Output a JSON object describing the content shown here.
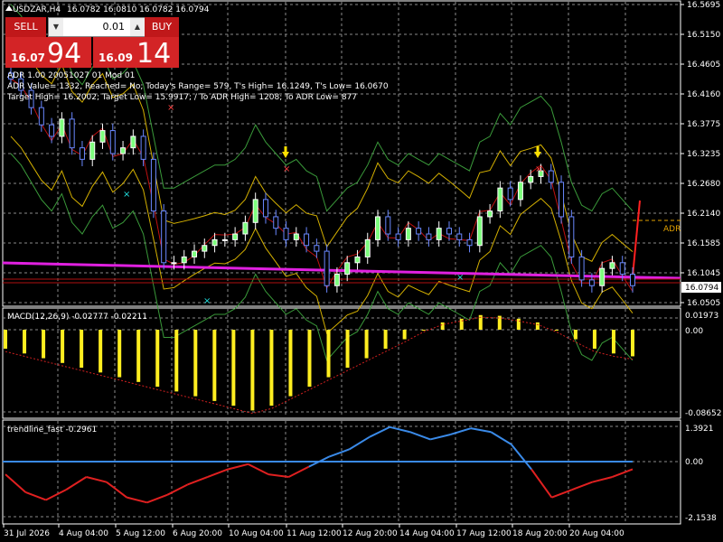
{
  "header": {
    "title": "USDZAR,H4",
    "ohlc": "16.0782 16.0810 16.0782 16.0794",
    "adr_line1": "ADR 1.00 20051027 01 Mod 01",
    "adr_line2": "ADR Value= 1332, Reached= No; Today's Range= 579, T's High= 16.1249, T's Low= 16.0670",
    "adr_line3": "Target High= 16.2002; Target Low= 15.9917; / To ADR High= 1208; To ADR Low= 877"
  },
  "trade": {
    "sell_label": "SELL",
    "buy_label": "BUY",
    "lot_value": "0.01",
    "sell_small": "16.07",
    "sell_big": "94",
    "buy_small": "16.09",
    "buy_big": "14"
  },
  "price_axis": {
    "labels": [
      "16.5695",
      "16.5150",
      "16.4605",
      "16.4160",
      "16.3775",
      "16.3235",
      "16.2680",
      "16.2140",
      "16.1585",
      "16.1045",
      "16.0505"
    ],
    "current": "16.0794",
    "adr_tag": "ADR"
  },
  "macd": {
    "label": "MACD(12,26,9) -0.02777 -0.02211",
    "axis": [
      "0.01973",
      "0.00",
      "-0.08652"
    ]
  },
  "trendline": {
    "label": "trendline_fast -0.2961",
    "axis": [
      "1.3921",
      "0.00",
      "-2.1538"
    ]
  },
  "time_axis": [
    "31 Jul 2026",
    "4 Aug 04:00",
    "5 Aug 12:00",
    "6 Aug 20:00",
    "10 Aug 04:00",
    "11 Aug 12:00",
    "12 Aug 20:00",
    "14 Aug 04:00",
    "17 Aug 12:00",
    "18 Aug 20:00",
    "20 Aug 04:00"
  ],
  "chart_data": {
    "type": "line",
    "symbol": "USDZAR",
    "timeframe": "H4",
    "ylim": [
      16.0505,
      16.5695
    ],
    "series": [
      {
        "name": "USDZAR",
        "values": [
          16.44,
          16.42,
          16.39,
          16.36,
          16.34,
          16.37,
          16.32,
          16.3,
          16.33,
          16.35,
          16.31,
          16.32,
          16.34,
          16.3,
          16.21,
          16.12,
          16.12,
          16.13,
          16.14,
          16.15,
          16.16,
          16.16,
          16.17,
          16.19,
          16.23,
          16.2,
          16.18,
          16.16,
          16.17,
          16.15,
          16.14,
          16.08,
          16.1,
          16.12,
          16.13,
          16.16,
          16.2,
          16.17,
          16.16,
          16.18,
          16.17,
          16.16,
          16.18,
          16.17,
          16.16,
          16.15,
          16.2,
          16.21,
          16.25,
          16.23,
          16.26,
          16.27,
          16.28,
          16.26,
          16.2,
          16.13,
          16.09,
          16.08,
          16.11,
          16.12,
          16.1,
          16.08
        ]
      },
      {
        "name": "MACD",
        "values": [
          -0.02,
          -0.025,
          -0.03,
          -0.035,
          -0.04,
          -0.045,
          -0.05,
          -0.055,
          -0.06,
          -0.065,
          -0.07,
          -0.075,
          -0.08,
          -0.085,
          -0.08,
          -0.07,
          -0.06,
          -0.05,
          -0.04,
          -0.03,
          -0.02,
          -0.01,
          0.0,
          0.01,
          0.015,
          0.02,
          0.019,
          0.015,
          0.01,
          0.0,
          -0.01,
          -0.02,
          -0.025,
          -0.028
        ]
      },
      {
        "name": "trendline_fast",
        "values": [
          -0.5,
          -1.2,
          -1.5,
          -1.1,
          -0.6,
          -0.8,
          -1.4,
          -1.6,
          -1.3,
          -0.9,
          -0.6,
          -0.3,
          -0.1,
          -0.5,
          -0.6,
          -0.2,
          0.2,
          0.5,
          1.0,
          1.4,
          1.2,
          0.9,
          1.1,
          1.35,
          1.2,
          0.7,
          -0.3,
          -1.4,
          -1.1,
          -0.8,
          -0.6,
          -0.3
        ]
      }
    ]
  }
}
